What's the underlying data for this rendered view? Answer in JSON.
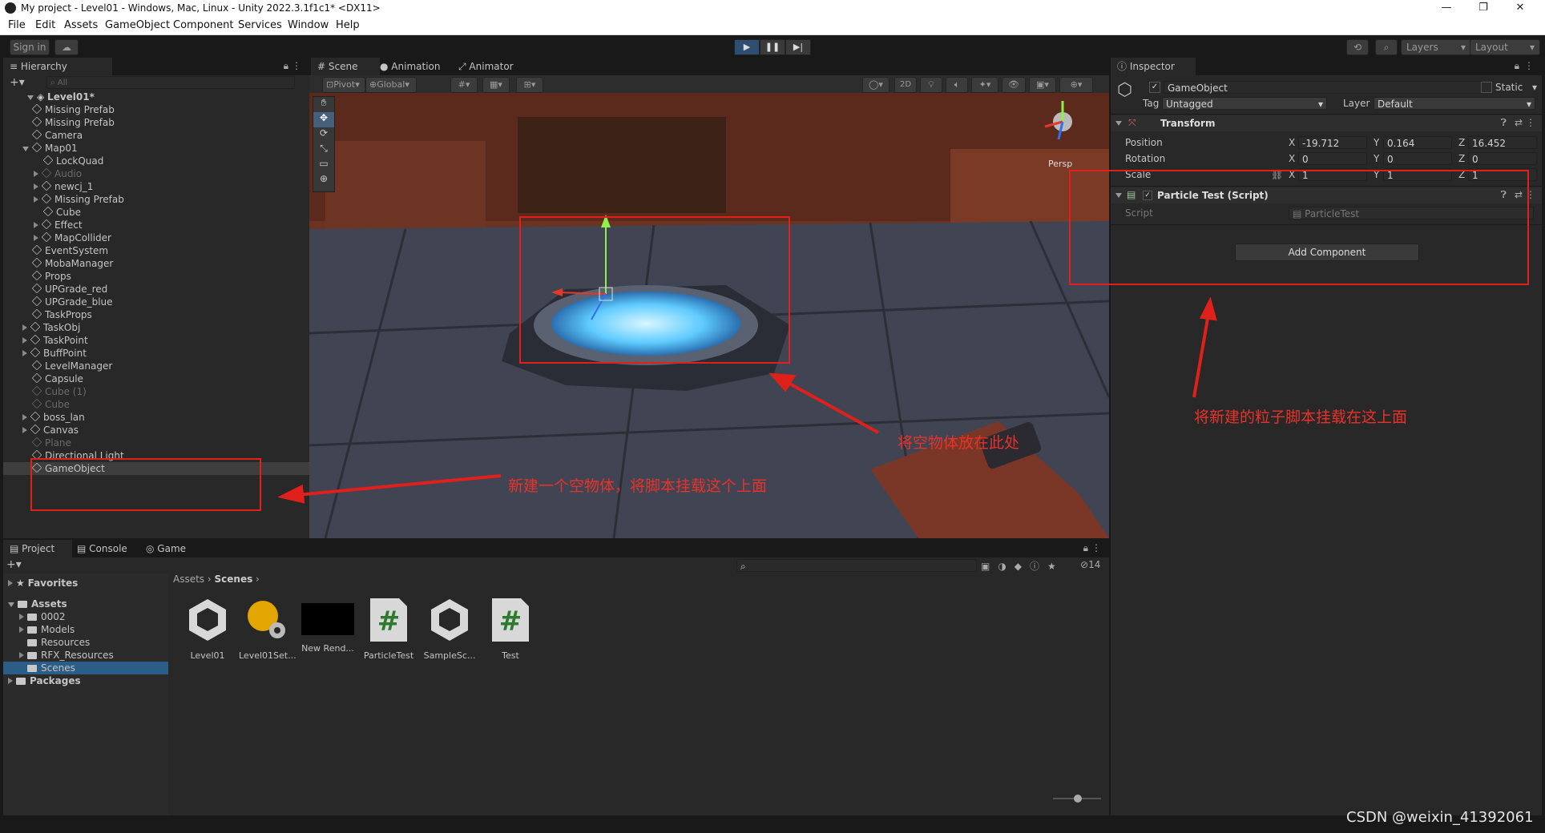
{
  "window": {
    "title": "My project - Level01 - Windows, Mac, Linux - Unity 2022.3.1f1c1* <DX11>",
    "min": "—",
    "max": "❐",
    "close": "✕"
  },
  "menu": [
    "File",
    "Edit",
    "Assets",
    "GameObject",
    "Component",
    "Services",
    "Window",
    "Help"
  ],
  "toolbar": {
    "sign_in": "Sign in",
    "layers": "Layers",
    "layout": "Layout"
  },
  "hierarchy": {
    "tab": "Hierarchy",
    "search_placeholder": "All",
    "scene": "Level01*",
    "items": [
      {
        "name": "Missing Prefab",
        "depth": 1,
        "arrow": "",
        "dim": false
      },
      {
        "name": "Missing Prefab",
        "depth": 1,
        "arrow": "",
        "dim": false
      },
      {
        "name": "Camera",
        "depth": 1,
        "arrow": "",
        "dim": false
      },
      {
        "name": "Map01",
        "depth": 1,
        "arrow": "open",
        "dim": false
      },
      {
        "name": "LockQuad",
        "depth": 2,
        "arrow": "",
        "dim": false
      },
      {
        "name": "Audio",
        "depth": 2,
        "arrow": "closed",
        "dim": true
      },
      {
        "name": "newcj_1",
        "depth": 2,
        "arrow": "closed",
        "dim": false
      },
      {
        "name": "Missing Prefab",
        "depth": 2,
        "arrow": "closed",
        "dim": false
      },
      {
        "name": "Cube",
        "depth": 2,
        "arrow": "",
        "dim": false
      },
      {
        "name": "Effect",
        "depth": 2,
        "arrow": "closed",
        "dim": false
      },
      {
        "name": "MapCollider",
        "depth": 2,
        "arrow": "closed",
        "dim": false
      },
      {
        "name": "EventSystem",
        "depth": 1,
        "arrow": "",
        "dim": false
      },
      {
        "name": "MobaManager",
        "depth": 1,
        "arrow": "",
        "dim": false
      },
      {
        "name": "Props",
        "depth": 1,
        "arrow": "",
        "dim": false
      },
      {
        "name": "UPGrade_red",
        "depth": 1,
        "arrow": "",
        "dim": false
      },
      {
        "name": "UPGrade_blue",
        "depth": 1,
        "arrow": "",
        "dim": false
      },
      {
        "name": "TaskProps",
        "depth": 1,
        "arrow": "",
        "dim": false
      },
      {
        "name": "TaskObj",
        "depth": 1,
        "arrow": "closed",
        "dim": false
      },
      {
        "name": "TaskPoint",
        "depth": 1,
        "arrow": "closed",
        "dim": false
      },
      {
        "name": "BuffPoint",
        "depth": 1,
        "arrow": "closed",
        "dim": false
      },
      {
        "name": "LevelManager",
        "depth": 1,
        "arrow": "",
        "dim": false
      },
      {
        "name": "Capsule",
        "depth": 1,
        "arrow": "",
        "dim": false
      },
      {
        "name": "Cube (1)",
        "depth": 1,
        "arrow": "",
        "dim": true
      },
      {
        "name": "Cube",
        "depth": 1,
        "arrow": "",
        "dim": true
      },
      {
        "name": "boss_lan",
        "depth": 1,
        "arrow": "closed",
        "dim": false
      },
      {
        "name": "Canvas",
        "depth": 1,
        "arrow": "closed",
        "dim": false
      },
      {
        "name": "Plane",
        "depth": 1,
        "arrow": "",
        "dim": true
      },
      {
        "name": "Directional Light",
        "depth": 1,
        "arrow": "",
        "dim": false
      },
      {
        "name": "GameObject",
        "depth": 1,
        "arrow": "",
        "dim": false
      }
    ]
  },
  "scene_tabs": [
    "Scene",
    "Animation",
    "Animator"
  ],
  "scene_toolbar": {
    "pivot": "Pivot",
    "global": "Global",
    "mode2d": "2D",
    "persp": "Persp"
  },
  "inspector": {
    "tab": "Inspector",
    "object_name": "GameObject",
    "static_label": "Static",
    "tag_label": "Tag",
    "tag_value": "Untagged",
    "layer_label": "Layer",
    "layer_value": "Default",
    "transform": {
      "title": "Transform",
      "position": {
        "label": "Position",
        "x": "-19.712",
        "y": "0.164",
        "z": "16.452"
      },
      "rotation": {
        "label": "Rotation",
        "x": "0",
        "y": "0",
        "z": "0"
      },
      "scale": {
        "label": "Scale",
        "x": "1",
        "y": "1",
        "z": "1"
      }
    },
    "script_component": {
      "title": "Particle Test (Script)",
      "script_label": "Script",
      "script_value": "ParticleTest"
    },
    "add_component": "Add Component"
  },
  "bottom_tabs": [
    "Project",
    "Console",
    "Game"
  ],
  "project": {
    "favorites": "Favorites",
    "assets": "Assets",
    "folders": [
      "0002",
      "Models",
      "Resources",
      "RFX_Resources",
      "Scenes"
    ],
    "packages": "Packages",
    "breadcrumb": [
      "Assets",
      "Scenes"
    ],
    "hidden_count": "14",
    "files": [
      {
        "name": "Level01",
        "icon": "unity-scene-icon"
      },
      {
        "name": "Level01Set...",
        "icon": "lighting-settings-icon"
      },
      {
        "name": "New Rend...",
        "icon": "render-texture-icon"
      },
      {
        "name": "ParticleTest",
        "icon": "csharp-script-icon"
      },
      {
        "name": "SampleSc...",
        "icon": "unity-scene-icon"
      },
      {
        "name": "Test",
        "icon": "csharp-script-icon"
      }
    ]
  },
  "annotations": {
    "place_here": "将空物体放在此处",
    "new_empty": "新建一个空物体，将脚本挂载这个上面",
    "attach_script": "将新建的粒子脚本挂载在这上面"
  },
  "watermark": "CSDN @weixin_41392061",
  "colors": {
    "annotation_red": "#e0201a",
    "selection_blue": "#2c5d87",
    "panel_bg": "#282828"
  }
}
